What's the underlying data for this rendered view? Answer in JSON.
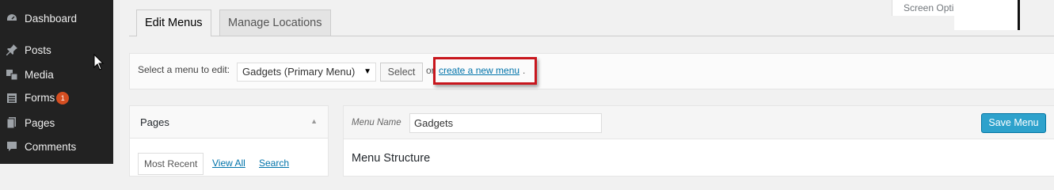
{
  "sidebar": {
    "items": [
      {
        "label": "Dashboard",
        "icon": "dashboard-icon"
      },
      {
        "label": "Posts",
        "icon": "pin-icon"
      },
      {
        "label": "Media",
        "icon": "media-icon"
      },
      {
        "label": "Forms",
        "icon": "forms-icon",
        "badge": "1"
      },
      {
        "label": "Pages",
        "icon": "pages-icon"
      },
      {
        "label": "Comments",
        "icon": "comments-icon"
      }
    ]
  },
  "tabs": {
    "edit_menus": "Edit Menus",
    "manage_locations": "Manage Locations"
  },
  "screen_options": "Screen Opti",
  "select_bar": {
    "label": "Select a menu to edit:",
    "selected_menu": "Gadgets (Primary Menu)",
    "select_button": "Select",
    "or_text": "or",
    "create_link": "create a new menu",
    "create_suffix": "."
  },
  "pages_box": {
    "title": "Pages",
    "tab_most_recent": "Most Recent",
    "tab_view_all": "View All",
    "tab_search": "Search"
  },
  "editor": {
    "menu_name_label": "Menu Name",
    "menu_name_value": "Gadgets",
    "save_button": "Save Menu",
    "structure_title": "Menu Structure"
  },
  "colors": {
    "sidebar_bg": "#222222",
    "highlight": "#c8161d",
    "link": "#0073aa",
    "primary_button": "#2ea2cc",
    "badge": "#d54e21"
  }
}
